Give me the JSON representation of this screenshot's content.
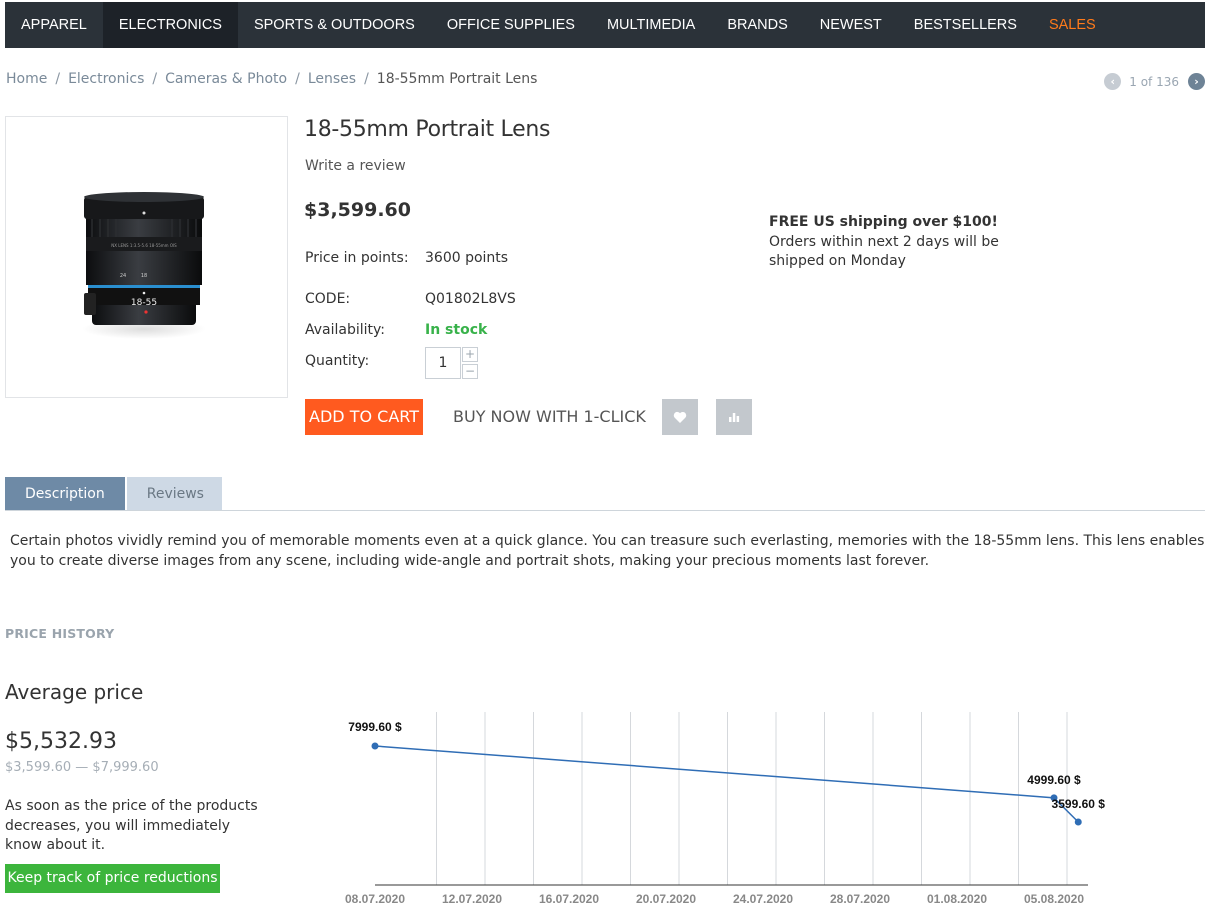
{
  "nav": {
    "items": [
      {
        "label": "APPAREL",
        "active": false
      },
      {
        "label": "ELECTRONICS",
        "active": true
      },
      {
        "label": "SPORTS & OUTDOORS",
        "active": false
      },
      {
        "label": "OFFICE SUPPLIES",
        "active": false
      },
      {
        "label": "MULTIMEDIA",
        "active": false
      },
      {
        "label": "BRANDS",
        "active": false
      },
      {
        "label": "NEWEST",
        "active": false
      },
      {
        "label": "BESTSELLERS",
        "active": false
      },
      {
        "label": "SALES",
        "active": false
      }
    ]
  },
  "breadcrumb": [
    "Home",
    "Electronics",
    "Cameras & Photo",
    "Lenses",
    "18-55mm Portrait Lens"
  ],
  "pager": {
    "text": "1 of 136"
  },
  "product": {
    "title": "18-55mm Portrait Lens",
    "review_link": "Write a review",
    "price": "$3,599.60",
    "points_label": "Price in points:",
    "points_value": "3600 points",
    "code_label": "CODE:",
    "code_value": "Q01802L8VS",
    "availability_label": "Availability:",
    "availability_value": "In stock",
    "quantity_label": "Quantity:",
    "quantity_value": "1",
    "qty_plus": "+",
    "qty_minus": "−",
    "lens_marking": "18-55",
    "add_to_cart": "ADD TO CART",
    "buy_now": "BUY NOW WITH 1-CLICK"
  },
  "shipping": {
    "heading": "FREE US shipping over $100!",
    "text": "Orders within next 2 days will be shipped on Monday"
  },
  "tabs": [
    "Description",
    "Reviews"
  ],
  "description": "Certain photos vividly remind you of memorable moments even at a quick glance. You can treasure such everlasting, memories with the 18-55mm lens. This lens enables you to create diverse images from any scene, including wide-angle and portrait shots, making your precious moments last forever.",
  "price_history": {
    "section_title": "PRICE HISTORY",
    "average_heading": "Average price",
    "average_price": "$5,532.93",
    "range": "$3,599.60 — $7,999.60",
    "text": "As soon as the price of the products decreases, you will immediately know about it.",
    "track_button": "Keep track of price reductions"
  },
  "colors": {
    "nav_bg": "#2b3239",
    "sales": "#ff7a1a",
    "cart": "#ff5a1f",
    "instock": "#38b24a",
    "track": "#3cb53c",
    "line": "#2f6db5"
  },
  "icons": {
    "wishlist": "heart-icon",
    "compare": "bar-chart-icon",
    "prev": "chevron-left-icon",
    "next": "chevron-right-icon"
  },
  "chart_data": {
    "type": "line",
    "x_ticks": [
      "08.07.2020",
      "12.07.2020",
      "16.07.2020",
      "20.07.2020",
      "24.07.2020",
      "28.07.2020",
      "01.08.2020",
      "05.08.2020"
    ],
    "series": [
      {
        "points": [
          {
            "x": "08.07.2020",
            "y": 7999.6,
            "label": "7999.60 $"
          },
          {
            "x": "05.08.2020",
            "y": 4999.6,
            "label": "4999.60 $"
          },
          {
            "x": "06.08.2020",
            "y": 3599.6,
            "label": "3599.60 $"
          }
        ]
      }
    ],
    "grid": "vertical"
  }
}
